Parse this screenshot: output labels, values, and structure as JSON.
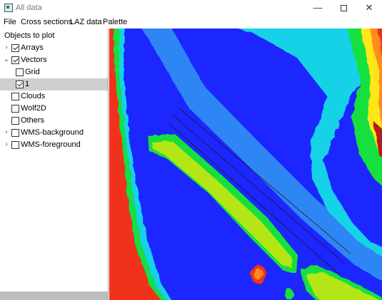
{
  "window": {
    "title": "All data",
    "minimize_glyph": "—",
    "close_glyph": "✕"
  },
  "menu": [
    "File",
    "Cross sections",
    "LAZ data",
    "Palette"
  ],
  "panel": {
    "title": "Objects to plot",
    "items": [
      {
        "label": "Arrays",
        "checked": true,
        "expander": "collapsed",
        "indent": 0,
        "selected": false
      },
      {
        "label": "Vectors",
        "checked": true,
        "expander": "expanded",
        "indent": 0,
        "selected": false
      },
      {
        "label": "Grid",
        "checked": false,
        "expander": "none",
        "indent": 1,
        "selected": false
      },
      {
        "label": "1",
        "checked": true,
        "expander": "none",
        "indent": 1,
        "selected": true
      },
      {
        "label": "Clouds",
        "checked": false,
        "expander": "none",
        "indent": 0,
        "selected": false
      },
      {
        "label": "Wolf2D",
        "checked": false,
        "expander": "none",
        "indent": 0,
        "selected": false
      },
      {
        "label": "Others",
        "checked": false,
        "expander": "none",
        "indent": 0,
        "selected": false
      },
      {
        "label": "WMS-background",
        "checked": false,
        "expander": "collapsed",
        "indent": 0,
        "selected": false
      },
      {
        "label": "WMS-foreground",
        "checked": false,
        "expander": "collapsed",
        "indent": 0,
        "selected": false
      }
    ]
  },
  "map": {
    "colors": {
      "blue": "#1a28ff",
      "light_blue": "#2f86f5",
      "cyan": "#19d2e6",
      "green": "#14e03c",
      "yellow_green": "#b4e614",
      "yellow": "#ffe614",
      "orange": "#ff8c1e",
      "red": "#f0321e",
      "dark_red": "#b41e1e"
    }
  }
}
